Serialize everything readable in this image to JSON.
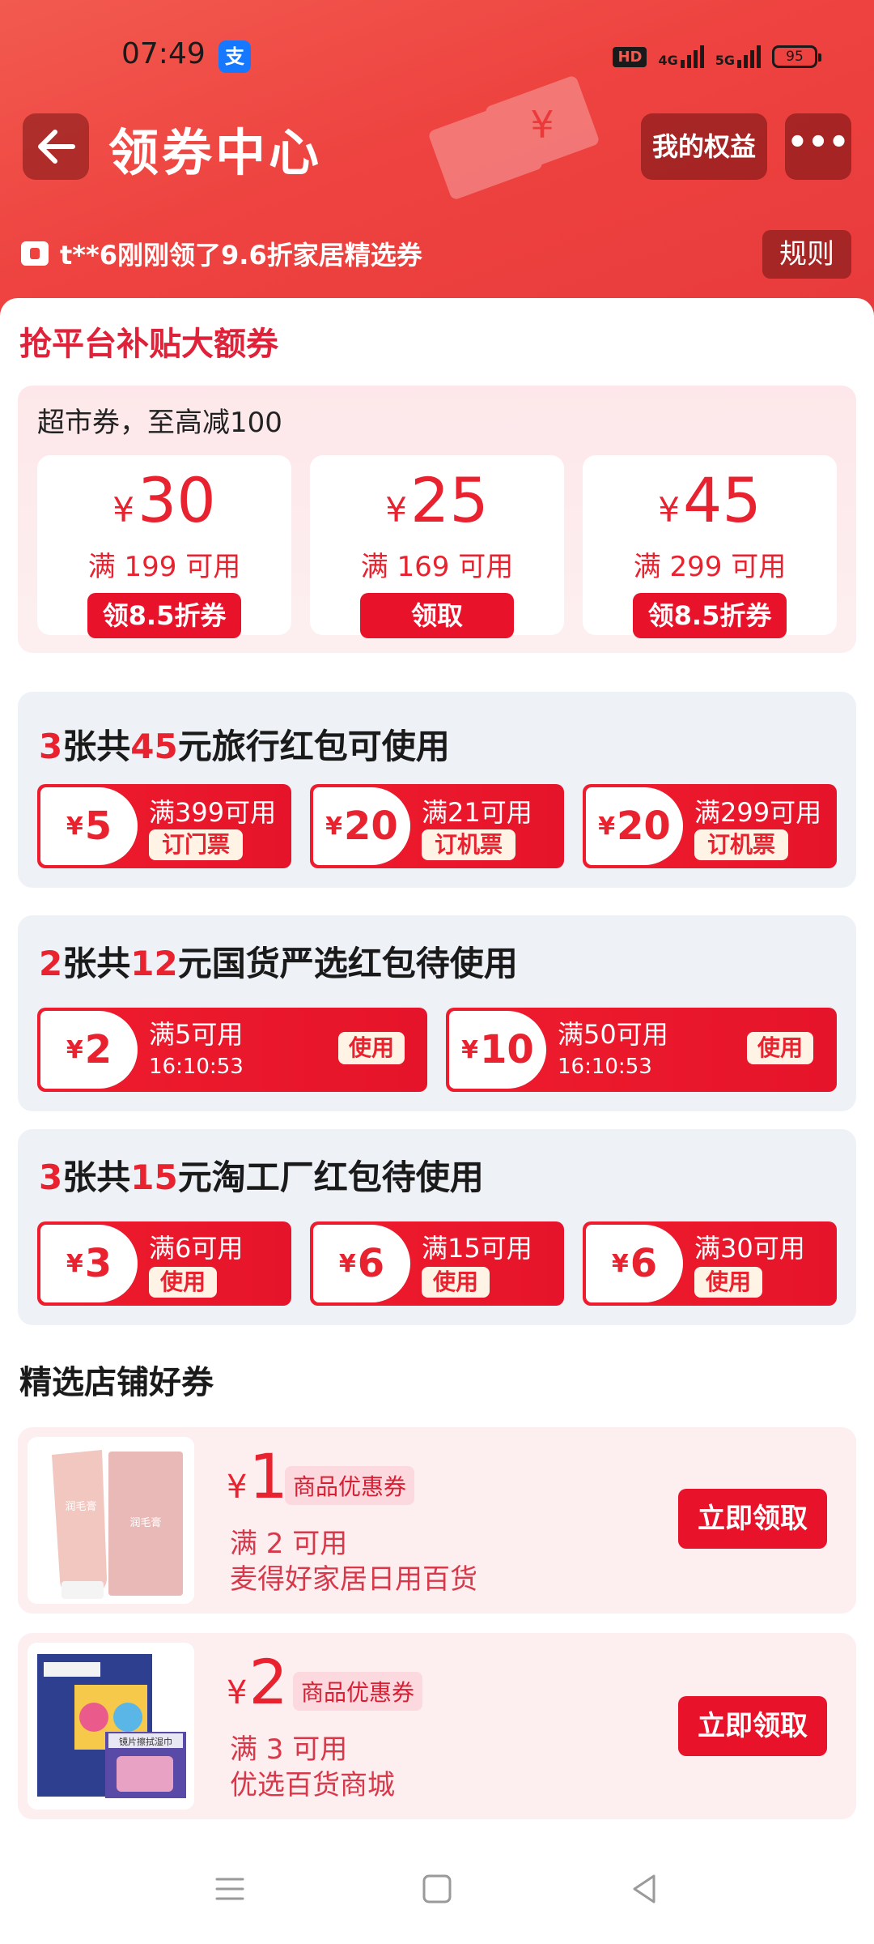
{
  "status": {
    "time": "07:49",
    "app_icon": "支",
    "hd": "HD",
    "net1": "4G",
    "net2": "5G",
    "battery": "95"
  },
  "header": {
    "title": "领券中心",
    "rights_label": "我的权益",
    "more_label": "•••",
    "notice": "t**6刚刚领了9.6折家居精选券",
    "rules_label": "规则"
  },
  "platform": {
    "title": "抢平台补贴大额券",
    "subtitle": "超市券，至高减100",
    "cards": [
      {
        "currency": "¥",
        "amount": "30",
        "condition": "满 199 可用",
        "button": "领8.5折券"
      },
      {
        "currency": "¥",
        "amount": "25",
        "condition": "满 169 可用",
        "button": "领取"
      },
      {
        "currency": "¥",
        "amount": "45",
        "condition": "满 299 可用",
        "button": "领8.5折券"
      }
    ]
  },
  "travel": {
    "count": "3",
    "unit1": "张共",
    "total": "45",
    "suffix": "元旅行红包可使用",
    "vouchers": [
      {
        "currency": "¥",
        "amount": "5",
        "condition": "满399可用",
        "tag": "订门票"
      },
      {
        "currency": "¥",
        "amount": "20",
        "condition": "满21可用",
        "tag": "订机票"
      },
      {
        "currency": "¥",
        "amount": "20",
        "condition": "满299可用",
        "tag": "订机票"
      }
    ]
  },
  "guohuo": {
    "count": "2",
    "unit1": "张共",
    "total": "12",
    "suffix": "元国货严选红包待使用",
    "vouchers": [
      {
        "currency": "¥",
        "amount": "2",
        "condition": "满5可用",
        "time": "16:10:53",
        "tag": "使用"
      },
      {
        "currency": "¥",
        "amount": "10",
        "condition": "满50可用",
        "time": "16:10:53",
        "tag": "使用"
      }
    ]
  },
  "factory": {
    "count": "3",
    "unit1": "张共",
    "total": "15",
    "suffix": "元淘工厂红包待使用",
    "vouchers": [
      {
        "currency": "¥",
        "amount": "3",
        "condition": "满6可用",
        "tag": "使用"
      },
      {
        "currency": "¥",
        "amount": "6",
        "condition": "满15可用",
        "tag": "使用"
      },
      {
        "currency": "¥",
        "amount": "6",
        "condition": "满30可用",
        "tag": "使用"
      }
    ]
  },
  "shops": {
    "title": "精选店铺好券",
    "items": [
      {
        "currency": "¥",
        "amount": "1",
        "badge": "商品优惠券",
        "condition": "满 2 可用",
        "shop": "麦得好家居日用百货",
        "button": "立即领取",
        "tube_label": "润毛膏"
      },
      {
        "currency": "¥",
        "amount": "2",
        "badge": "商品优惠券",
        "condition": "满 3 可用",
        "shop": "优选百货商城",
        "button": "立即领取",
        "box_label": "镜片擦拭湿巾"
      }
    ]
  },
  "colors": {
    "brand_red": "#e8222e",
    "header_red": "#ee4340",
    "grey_box": "#eef1f6",
    "pink_box": "#fdeef0"
  }
}
